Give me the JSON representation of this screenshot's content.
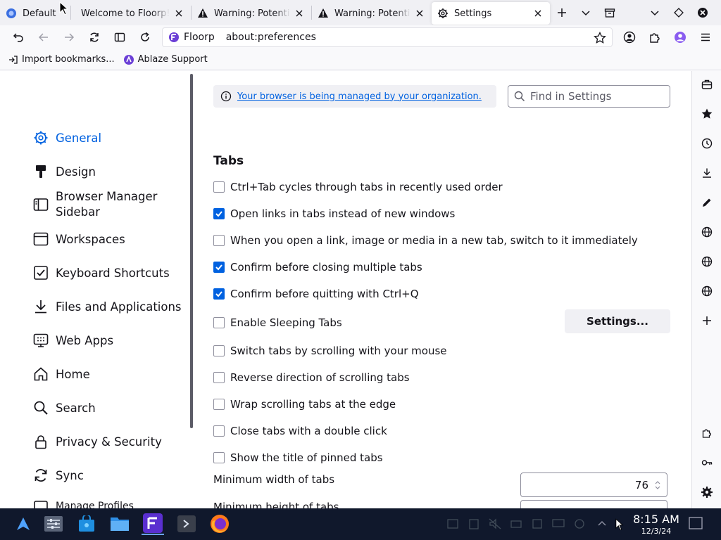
{
  "tabs": [
    {
      "title": "Default",
      "icon": "floorp-icon",
      "active": false
    },
    {
      "title": "Welcome to Floorp!",
      "icon": "none",
      "active": false
    },
    {
      "title": "Warning: Potentia",
      "icon": "warning-icon",
      "active": false
    },
    {
      "title": "Warning: Potentia",
      "icon": "warning-icon",
      "active": false
    },
    {
      "title": "Settings",
      "icon": "gear-icon",
      "active": true
    }
  ],
  "urlbar": {
    "identity_label": "Floorp",
    "url": "about:preferences"
  },
  "bookmarks": [
    {
      "label": "Import bookmarks...",
      "icon": "import-icon"
    },
    {
      "label": "Ablaze Support",
      "icon": "ablaze-icon"
    }
  ],
  "sidebar": {
    "categories": [
      {
        "label": "General",
        "icon": "gear-icon",
        "selected": true
      },
      {
        "label": "Design",
        "icon": "paintbrush-icon",
        "selected": false
      },
      {
        "label": "Browser Manager Sidebar",
        "icon": "sidebar-icon",
        "selected": false
      },
      {
        "label": "Workspaces",
        "icon": "workspaces-icon",
        "selected": false
      },
      {
        "label": "Keyboard Shortcuts",
        "icon": "checkbox-icon",
        "selected": false
      },
      {
        "label": "Files and Applications",
        "icon": "download-icon",
        "selected": false
      },
      {
        "label": "Web Apps",
        "icon": "webapps-icon",
        "selected": false
      },
      {
        "label": "Home",
        "icon": "home-icon",
        "selected": false
      },
      {
        "label": "Search",
        "icon": "search-icon",
        "selected": false
      },
      {
        "label": "Privacy & Security",
        "icon": "lock-icon",
        "selected": false
      },
      {
        "label": "Sync",
        "icon": "sync-icon",
        "selected": false
      },
      {
        "label": "Manage Profiles",
        "icon": "profiles-icon",
        "selected": false
      }
    ]
  },
  "policies": {
    "text": "Your browser is being managed by your organization."
  },
  "search": {
    "placeholder": "Find in Settings"
  },
  "tabs_section": {
    "title": "Tabs",
    "options": [
      {
        "label": "Ctrl+Tab cycles through tabs in recently used order",
        "checked": false
      },
      {
        "label": "Open links in tabs instead of new windows",
        "checked": true
      },
      {
        "label": "When you open a link, image or media in a new tab, switch to it immediately",
        "checked": false
      },
      {
        "label": "Confirm before closing multiple tabs",
        "checked": true
      },
      {
        "label": "Confirm before quitting with Ctrl+Q",
        "checked": true
      },
      {
        "label": "Enable Sleeping Tabs",
        "checked": false
      },
      {
        "label": "Switch tabs by scrolling with your mouse",
        "checked": false
      },
      {
        "label": "Reverse direction of scrolling tabs",
        "checked": false
      },
      {
        "label": "Wrap scrolling tabs at the edge",
        "checked": false
      },
      {
        "label": "Close tabs with a double click",
        "checked": false
      },
      {
        "label": "Show the title of pinned tabs",
        "checked": false
      }
    ],
    "sleeping_settings_label": "Settings...",
    "min_width_label": "Minimum width of tabs",
    "min_width_value": "76",
    "min_height_label": "Minimum height of tabs"
  },
  "right_sidebar": {
    "icons": [
      "briefcase-icon",
      "star-icon",
      "history-icon",
      "download-icon",
      "pen-icon",
      "globe-icon",
      "globe-icon",
      "globe-icon",
      "plus-icon",
      "puzzle-icon",
      "key-icon",
      "gear-icon"
    ]
  },
  "taskbar": {
    "time": "8:15 AM",
    "date": "12/3/24"
  },
  "colors": {
    "accent": "#0061e0",
    "taskbar": "#10182c",
    "tab_strip": "#f0f0f4"
  }
}
